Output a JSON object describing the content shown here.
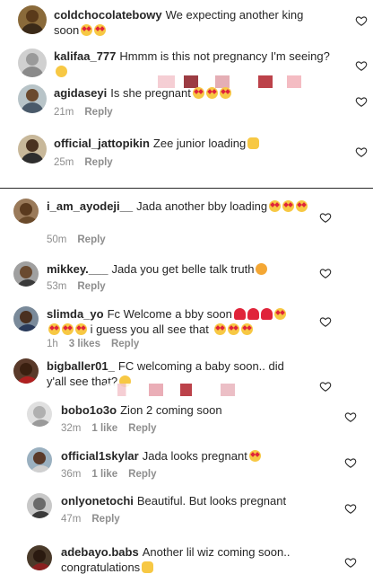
{
  "top_panel": {
    "comments": [
      {
        "user": "coldchocolatebowy",
        "text": "We expecting another king soon 😍😍",
        "time": "",
        "reply": ""
      },
      {
        "user": "kalifaa_777",
        "text": "Hmmm is this not pregnancy I'm seeing?😜",
        "time": "",
        "reply": ""
      },
      {
        "user": "agidaseyi",
        "text": "Is she pregnant 😍😍😍",
        "time": "21m",
        "reply": "Reply"
      },
      {
        "user": "official_jattopikin",
        "text": "Zee junior loading 🙌",
        "time": "25m",
        "reply": "Reply"
      }
    ]
  },
  "bottom_panel": {
    "comments": [
      {
        "user": "i_am_ayodeji__",
        "text": "Jada another bby loading 😍😍😍",
        "time": "50m",
        "likes": "",
        "reply": "Reply"
      },
      {
        "user": "mikkey.___",
        "text": "Jada you get belle talk truth 😏",
        "time": "53m",
        "likes": "",
        "reply": "Reply"
      },
      {
        "user": "slimda_yo",
        "text": "Fc Welcome a bby soon❤️❤️❤️😍😍😍😍 i guess you all see that 😍😍😍",
        "time": "1h",
        "likes": "3 likes",
        "reply": "Reply"
      },
      {
        "user": "bigballer01_",
        "text": "FC welcoming a baby soon.. did y'all see that?😜",
        "time": "",
        "likes": "",
        "reply": ""
      },
      {
        "user": "bobo1o3o",
        "text": "Zion 2 coming soon",
        "time": "32m",
        "likes": "1 like",
        "reply": "Reply"
      },
      {
        "user": "official1skylar",
        "text": "Jada looks pregnant 😍",
        "time": "36m",
        "likes": "1 like",
        "reply": "Reply"
      },
      {
        "user": "onlyonetochi",
        "text": "Beautiful. But looks pregnant",
        "time": "47m",
        "likes": "",
        "reply": "Reply"
      },
      {
        "user": "adebayo.babs",
        "text": "Another lil wiz coming soon.. congratulations🙌",
        "time": "",
        "likes": "",
        "reply": ""
      }
    ]
  },
  "icons": {
    "like": "heart-outline-icon",
    "avatar": "user-avatar"
  },
  "colors": {
    "text": "#262626",
    "meta": "#8e8e8e",
    "emoji_yellow": "#f7c844",
    "emoji_red": "#e0243a"
  }
}
